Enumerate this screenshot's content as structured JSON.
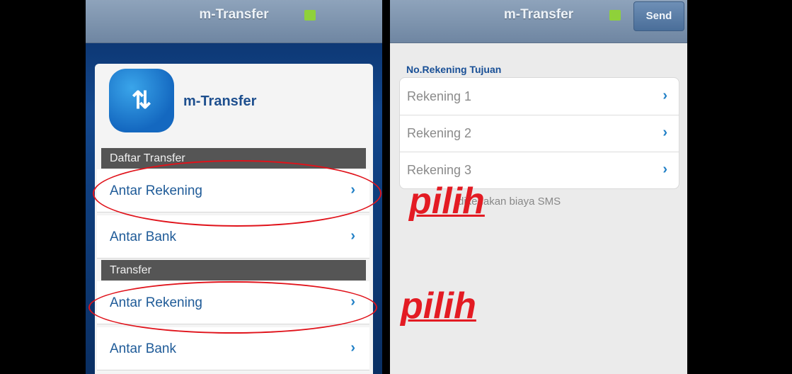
{
  "left_screen": {
    "title": "m-Transfer",
    "app_name": "m-Transfer",
    "icon": "transfer-arrows-icon",
    "sections": [
      {
        "header": "Daftar Transfer",
        "items": [
          "Antar Rekening",
          "Antar Bank"
        ]
      },
      {
        "header": "Transfer",
        "items": [
          "Antar Rekening",
          "Antar Bank"
        ]
      }
    ],
    "chevron": "›"
  },
  "right_screen": {
    "title": "m-Transfer",
    "send_label": "Send",
    "field_label": "No.Rekening Tujuan",
    "accounts": [
      "Rekening 1",
      "Rekening 2",
      "Rekening 3"
    ],
    "note": "dikenakan biaya SMS",
    "chevron": "›"
  },
  "annotations": {
    "pilih_1": "pilih",
    "pilih_2": "pilih"
  },
  "colors": {
    "annotation": "#e31b23",
    "status_indicator": "#8fd13a",
    "link_text": "#1f5b98"
  }
}
